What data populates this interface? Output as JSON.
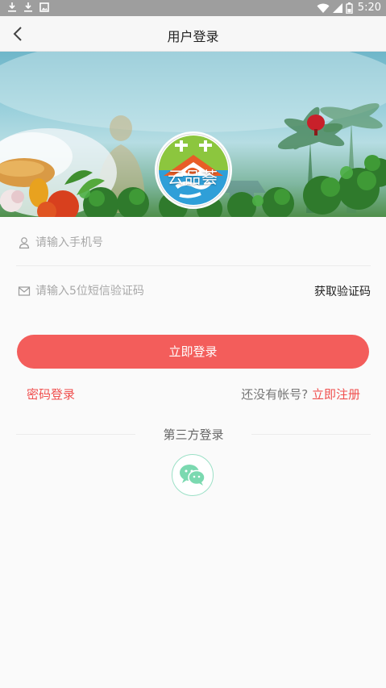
{
  "status_bar": {
    "time": "5:20",
    "icons": [
      "download-icon",
      "download-icon",
      "image-icon",
      "wifi-icon",
      "signal-icon",
      "battery-icon"
    ]
  },
  "nav": {
    "title": "用户登录",
    "back_icon": "chevron-left-icon"
  },
  "banner": {
    "brand_name": "云品荟"
  },
  "form": {
    "phone_placeholder": "请输入手机号",
    "code_placeholder": "请输入5位短信验证码",
    "get_code_label": "获取验证码",
    "login_button": "立即登录",
    "password_login": "密码登录",
    "no_account_prompt": "还没有帐号?",
    "register_link": "立即注册"
  },
  "third_party": {
    "label": "第三方登录",
    "wechat_icon": "wechat-icon"
  },
  "colors": {
    "accent": "#f35d5b",
    "link": "#f04f4e",
    "wechat": "#6fd3a8"
  }
}
